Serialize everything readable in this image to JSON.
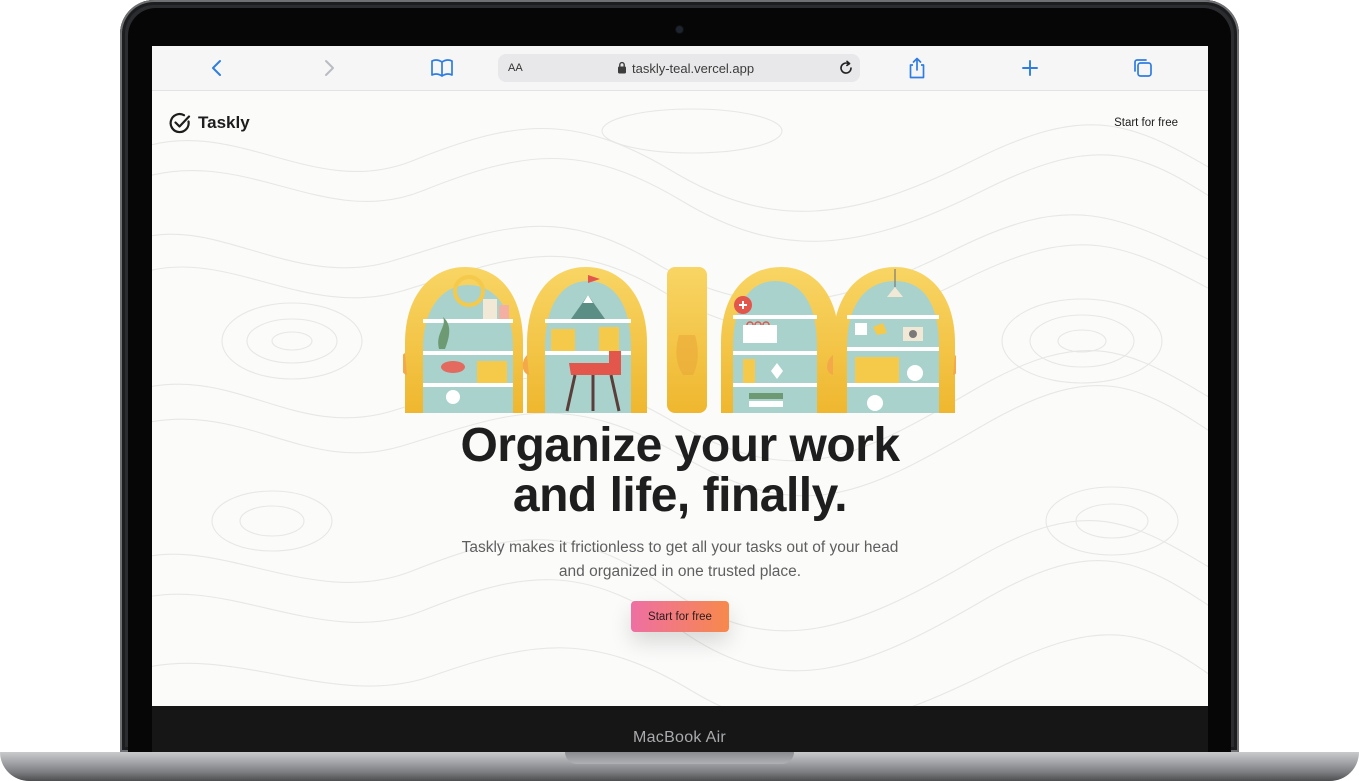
{
  "device": {
    "model_label": "MacBook Air"
  },
  "browser": {
    "address_bar": {
      "text_size_label": "AA",
      "url": "taskly-teal.vercel.app"
    },
    "icons": [
      "chevron-left-icon",
      "chevron-right-icon",
      "book-icon",
      "lock-icon",
      "reload-icon",
      "share-icon",
      "plus-icon",
      "tabs-icon"
    ],
    "accent_color": "#2f7de1"
  },
  "site": {
    "brand": "Taskly",
    "nav_cta": "Start for free",
    "hero": {
      "headline_line1": "Organize your work",
      "headline_line2": "and life, finally.",
      "subtext_line1": "Taskly makes it frictionless to get all your tasks out of your head",
      "subtext_line2": "and organized in one trusted place.",
      "cta": "Start for free"
    },
    "colors": {
      "cta_start": "#ee6fa3",
      "cta_end": "#f7894b",
      "illustration_yellow": "#f5c94a",
      "illustration_teal": "#a9d2cc"
    }
  }
}
